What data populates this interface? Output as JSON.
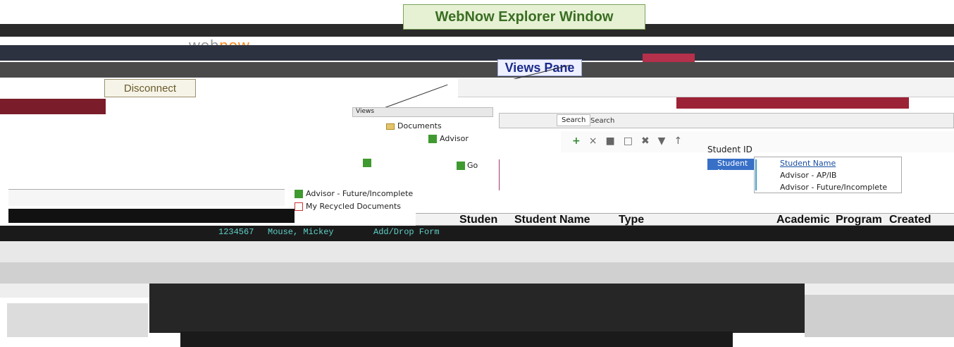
{
  "callouts": {
    "title": "WebNow Explorer Window",
    "views_pane": "Views Pane",
    "disconnect": "Disconnect"
  },
  "app": {
    "brand_prefix": "web",
    "brand_suffix": "now",
    "top_tab": "Documents"
  },
  "views": {
    "header": "Views",
    "tree": [
      {
        "label": "Documents",
        "icon": "folder-icon"
      },
      {
        "label": "Advisor",
        "icon": "view-icon"
      }
    ],
    "lower_items": [
      {
        "label": "Advisor - Future/Incomplete"
      },
      {
        "label": "My Recycled Documents"
      }
    ],
    "go_label": "Go"
  },
  "search": {
    "tab_label": "Search",
    "field_label": "Search",
    "fields": [
      {
        "label": "Student ID"
      },
      {
        "label": "Student Name"
      }
    ],
    "dropdown": [
      {
        "label": "Student Name"
      },
      {
        "label": "Advisor - AP/IB"
      },
      {
        "label": "Advisor - Future/Incomplete"
      }
    ]
  },
  "grid": {
    "columns": [
      "Studen",
      "Student Name",
      "Type",
      "Academic",
      "Program",
      "Created"
    ],
    "first_row": {
      "id": "1234567",
      "name": "Mouse, Mickey",
      "type": "Add/Drop Form"
    }
  }
}
